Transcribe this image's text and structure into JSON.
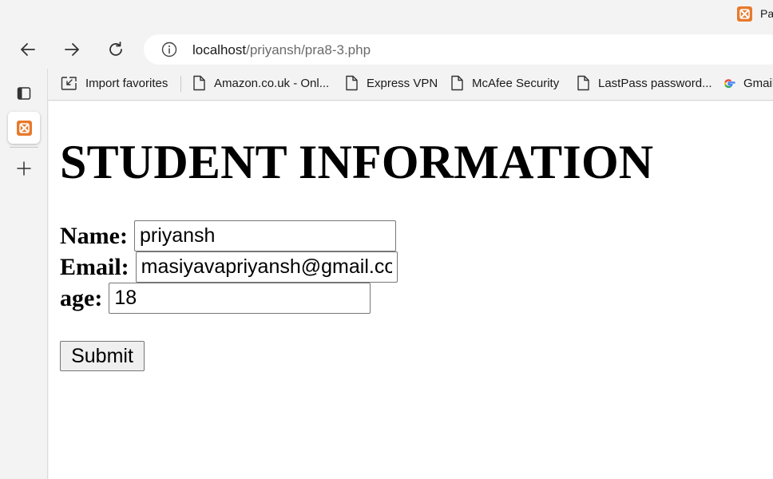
{
  "browser": {
    "tab": {
      "title": "Pa",
      "favicon_icon": "xampp-icon"
    },
    "nav": {
      "back_icon": "back-arrow-icon",
      "forward_icon": "forward-arrow-icon",
      "refresh_icon": "refresh-icon"
    },
    "address": {
      "host": "localhost",
      "path": "/priyansh/pra8-3.php",
      "info_icon": "info-icon"
    },
    "sidebar": {
      "items": [
        {
          "icon": "tab-actions-icon"
        },
        {
          "icon": "xampp-icon",
          "active": true
        },
        {
          "icon": "plus-icon"
        }
      ]
    },
    "favorites": [
      {
        "label": "Import favorites",
        "icon": "import-favorites-icon"
      },
      {
        "label": "Amazon.co.uk - Onl...",
        "icon": "page-icon"
      },
      {
        "label": "Express VPN",
        "icon": "page-icon"
      },
      {
        "label": "McAfee Security",
        "icon": "page-icon"
      },
      {
        "label": "LastPass password...",
        "icon": "page-icon"
      },
      {
        "label": "Gmail",
        "icon": "google-icon"
      }
    ]
  },
  "page": {
    "title": "STUDENT INFORMATION",
    "form": {
      "name": {
        "label": "Name:",
        "value": "priyansh"
      },
      "email": {
        "label": "Email:",
        "value": "masiyavapriyansh@gmail.com"
      },
      "age": {
        "label": "age:",
        "value": "18"
      },
      "submit_label": "Submit"
    }
  },
  "colors": {
    "chrome_bg": "#f3f3f3",
    "page_bg": "#ffffff",
    "xampp_orange": "#e8792c"
  }
}
